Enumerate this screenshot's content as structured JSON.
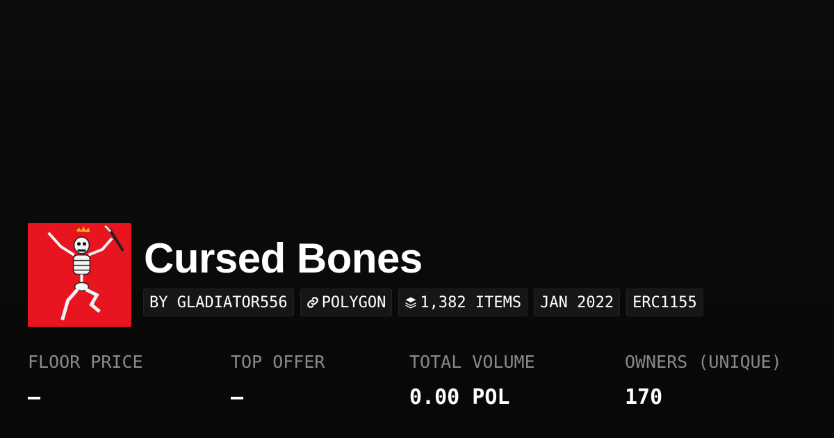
{
  "collection": {
    "name": "Cursed Bones",
    "image_color": "#e8141f"
  },
  "chips": [
    {
      "label": "BY GLADIATOR556",
      "icon": null
    },
    {
      "label": "POLYGON",
      "icon": "link-icon"
    },
    {
      "label": "1,382 ITEMS",
      "icon": "stack-layers-icon"
    },
    {
      "label": "JAN 2022",
      "icon": null
    },
    {
      "label": "ERC1155",
      "icon": null
    }
  ],
  "stats": [
    {
      "label": "FLOOR PRICE",
      "value": "–"
    },
    {
      "label": "TOP OFFER",
      "value": "–"
    },
    {
      "label": "TOTAL VOLUME",
      "value": "0.00 POL"
    },
    {
      "label": "OWNERS (UNIQUE)",
      "value": "170"
    }
  ],
  "colors": {
    "background": "#0a0a0a",
    "chip_background": "#161616",
    "label_gray": "#8a8a8a",
    "text": "#ffffff"
  }
}
